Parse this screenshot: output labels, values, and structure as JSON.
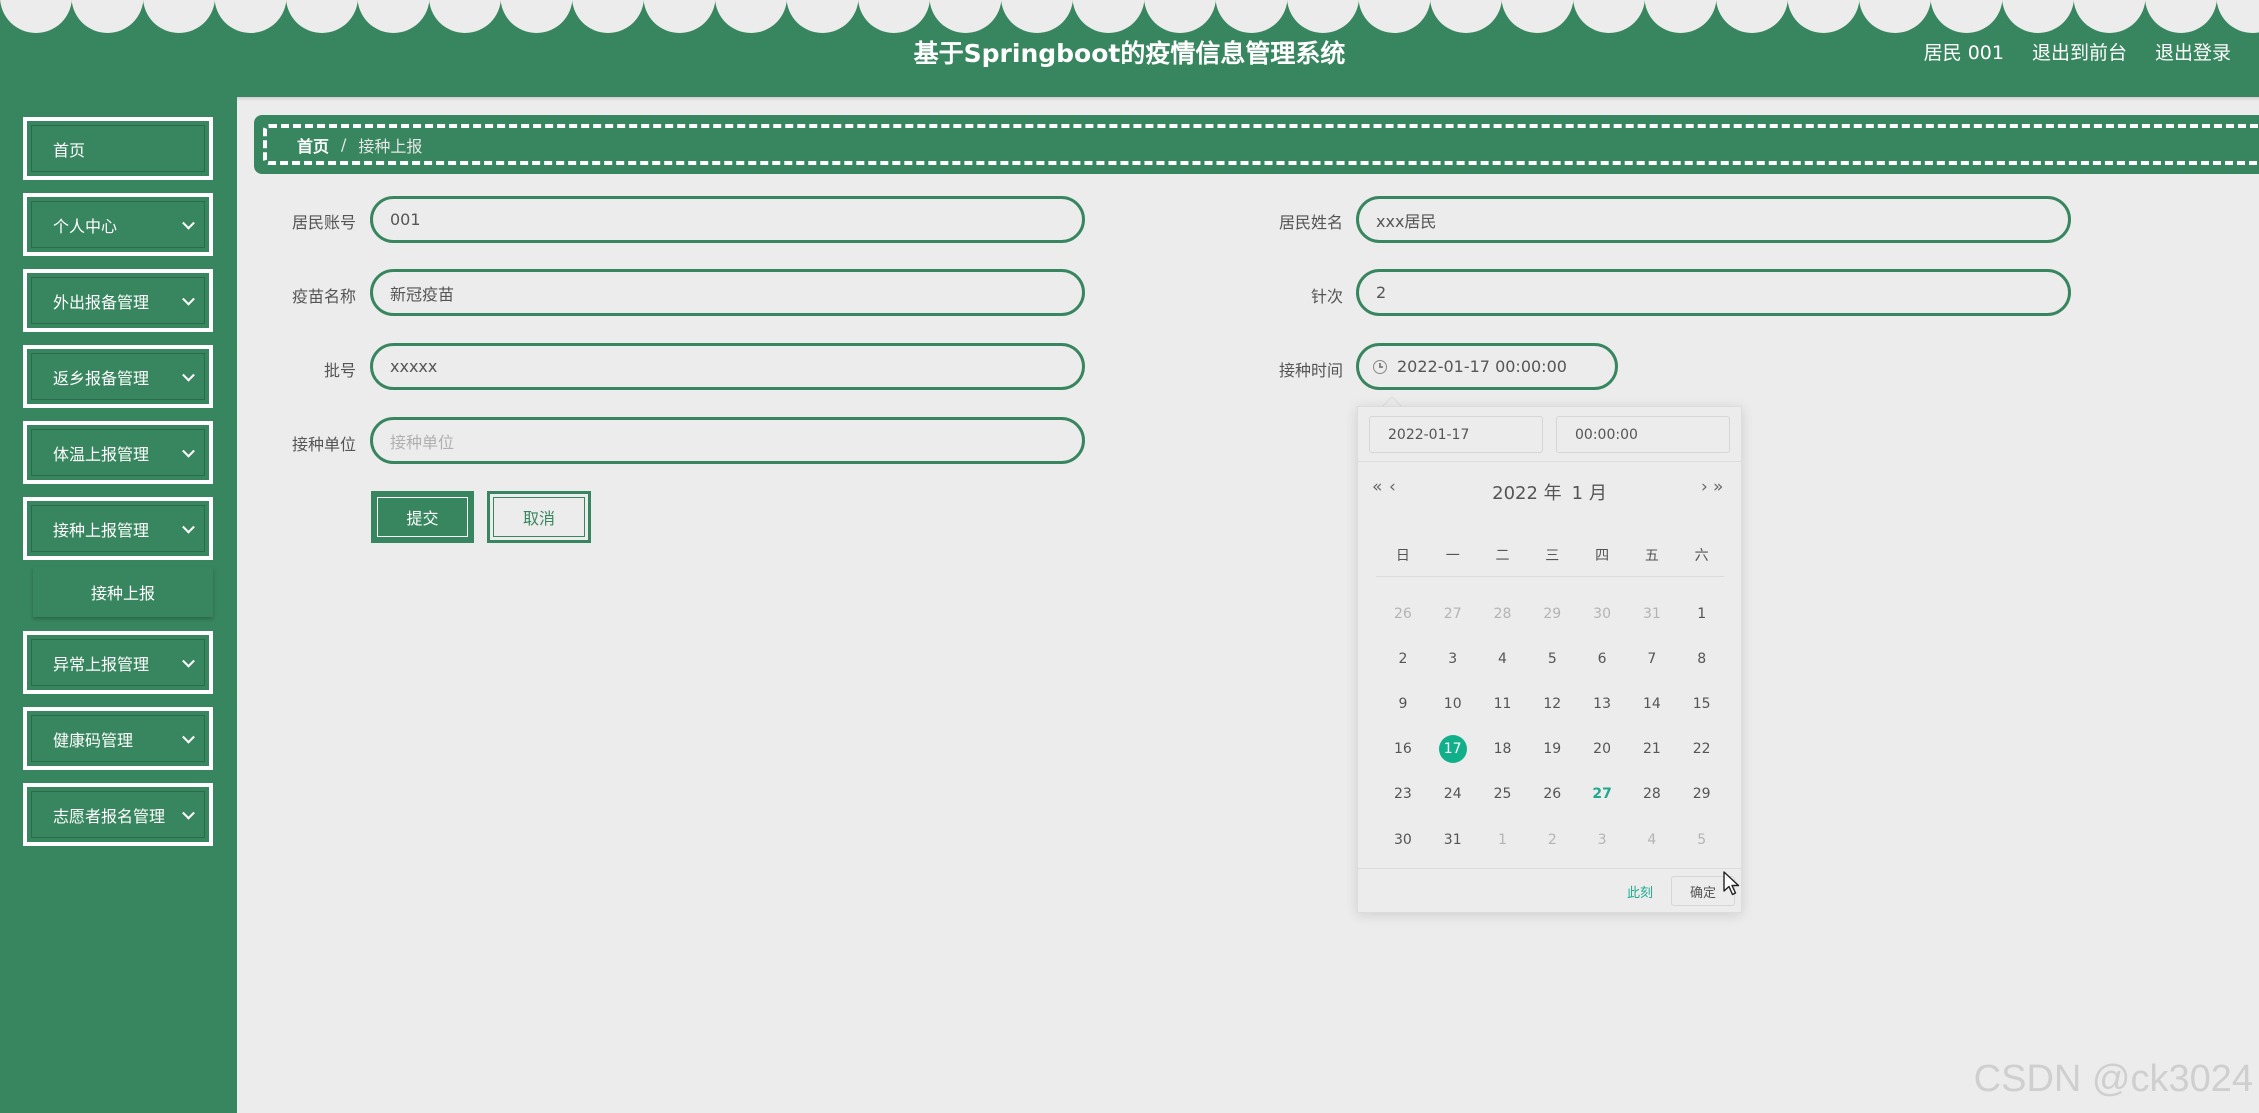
{
  "header": {
    "title": "基于Springboot的疫情信息管理系统",
    "user": "居民 001",
    "to_front": "退出到前台",
    "logout": "退出登录"
  },
  "sidebar": {
    "items": [
      {
        "label": "首页",
        "expandable": false
      },
      {
        "label": "个人中心",
        "expandable": true
      },
      {
        "label": "外出报备管理",
        "expandable": true
      },
      {
        "label": "返乡报备管理",
        "expandable": true
      },
      {
        "label": "体温上报管理",
        "expandable": true
      },
      {
        "label": "接种上报管理",
        "expandable": true
      },
      {
        "label": "异常上报管理",
        "expandable": true
      },
      {
        "label": "健康码管理",
        "expandable": true
      },
      {
        "label": "志愿者报名管理",
        "expandable": true
      }
    ],
    "submenu": {
      "label": "接种上报"
    }
  },
  "breadcrumb": {
    "home": "首页",
    "separator": "/",
    "current": "接种上报"
  },
  "form": {
    "resident_account": {
      "label": "居民账号",
      "value": "001"
    },
    "resident_name": {
      "label": "居民姓名",
      "value": "xxx居民"
    },
    "vaccine_name": {
      "label": "疫苗名称",
      "value": "新冠疫苗"
    },
    "dose": {
      "label": "针次",
      "value": "2"
    },
    "batch_no": {
      "label": "批号",
      "value": "xxxxx"
    },
    "vaccination_time": {
      "label": "接种时间",
      "value": "2022-01-17 00:00:00"
    },
    "vaccination_unit": {
      "label": "接种单位",
      "value": "",
      "placeholder": "接种单位"
    },
    "submit_label": "提交",
    "cancel_label": "取消"
  },
  "date_picker": {
    "date_value": "2022-01-17",
    "time_value": "00:00:00",
    "prev_year_icon": "«",
    "prev_month_icon": "‹",
    "next_month_icon": "›",
    "next_year_icon": "»",
    "year_label": "2022 年",
    "month_label": "1 月",
    "weekdays": [
      "日",
      "一",
      "二",
      "三",
      "四",
      "五",
      "六"
    ],
    "weeks": [
      [
        "26",
        "27",
        "28",
        "29",
        "30",
        "31",
        "1"
      ],
      [
        "2",
        "3",
        "4",
        "5",
        "6",
        "7",
        "8"
      ],
      [
        "9",
        "10",
        "11",
        "12",
        "13",
        "14",
        "15"
      ],
      [
        "16",
        "17",
        "18",
        "19",
        "20",
        "21",
        "22"
      ],
      [
        "23",
        "24",
        "25",
        "26",
        "27",
        "28",
        "29"
      ],
      [
        "30",
        "31",
        "1",
        "2",
        "3",
        "4",
        "5"
      ]
    ],
    "selected_day": "17",
    "today_day": "27",
    "now_label": "此刻",
    "confirm_label": "确定"
  },
  "watermark": "CSDN @ck3024",
  "colors": {
    "primary": "#38865f",
    "background": "#ececec",
    "accent": "#12b08a"
  }
}
